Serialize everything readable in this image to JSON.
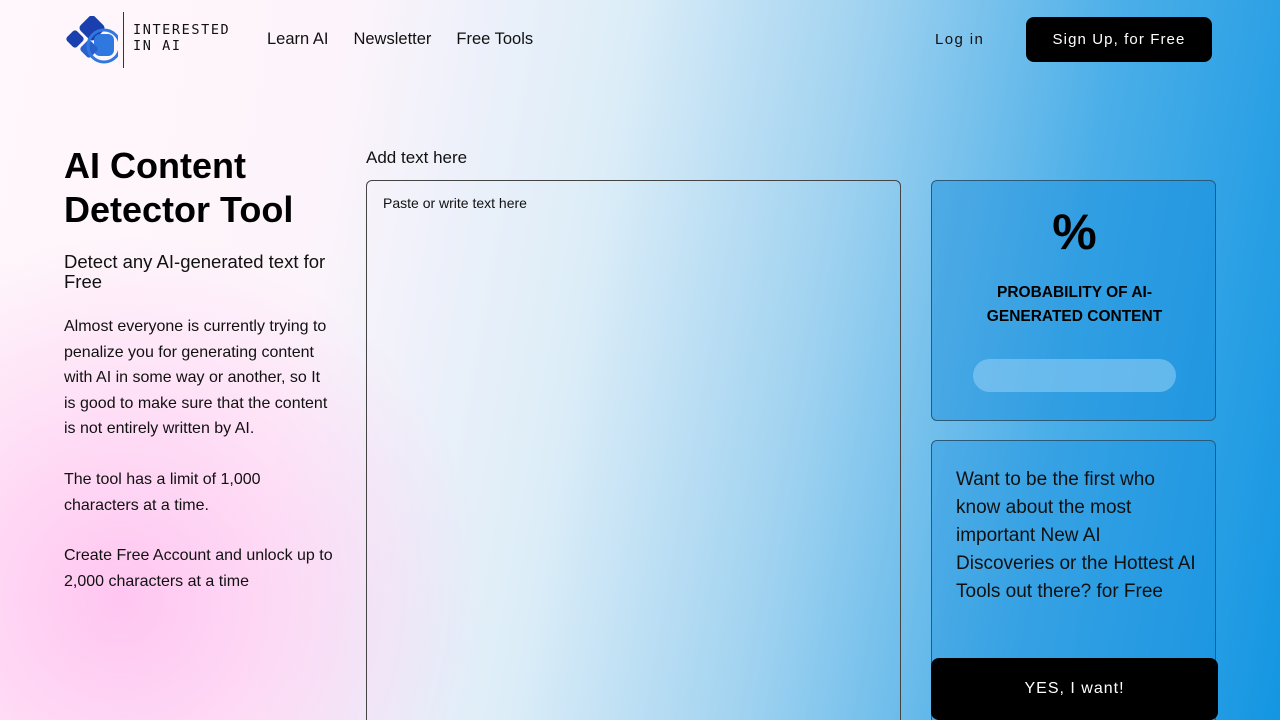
{
  "brand": {
    "logo_text": "INTERESTED IN AI",
    "colors": {
      "logo_dark": "#1a3fae",
      "logo_light": "#2f78e0"
    }
  },
  "nav": {
    "items": [
      "Learn AI",
      "Newsletter",
      "Free Tools"
    ]
  },
  "auth": {
    "login_label": "Log in",
    "signup_label": "Sign Up, for Free"
  },
  "hero": {
    "title": "AI Content Detector Tool",
    "subtitle": "Detect any AI-generated text for Free",
    "paragraphs": [
      "Almost everyone is currently trying to penalize you for generating content with AI in some way or another, so It is good to make sure that the content is not entirely written by AI.",
      "The tool has a limit of 1,000 characters at a time.",
      "Create Free Account and unlock up to 2,000 characters at a time"
    ]
  },
  "editor": {
    "label": "Add text here",
    "placeholder": "Paste or write text here"
  },
  "result": {
    "percent_symbol": "%",
    "label": "PROBABILITY OF AI-GENERATED CONTENT",
    "probability": 0
  },
  "newsletter": {
    "text": "Want to be the first who know about the most important New AI Discoveries or the Hottest AI Tools out there? for Free",
    "button_label": "YES, I want!"
  }
}
